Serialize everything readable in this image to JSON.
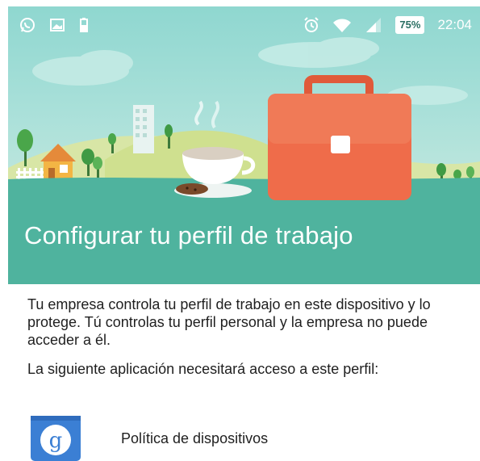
{
  "colors": {
    "header_teal": "#4fb39e",
    "sky": "#a9e0d9",
    "briefcase": "#ef6c4a",
    "app_icon_blue": "#3b7fd4"
  },
  "status_bar": {
    "left_icons": [
      "whatsapp-icon",
      "image-icon",
      "phone-battery-icon"
    ],
    "right_icons": [
      "alarm-icon",
      "wifi-icon",
      "signal-icon"
    ],
    "battery": "75%",
    "time": "22:04"
  },
  "header": {
    "title": "Configurar tu perfil de trabajo"
  },
  "body": {
    "paragraph_1": "Tu empresa controla tu perfil de trabajo en este dispositivo y lo protege. Tú controlas tu perfil personal y la empresa no puede acceder a él.",
    "paragraph_2": "La siguiente aplicación necesitará acceso a este perfil:"
  },
  "app": {
    "icon": "device-policy-icon",
    "icon_letter": "g",
    "label": "Política de dispositivos"
  }
}
